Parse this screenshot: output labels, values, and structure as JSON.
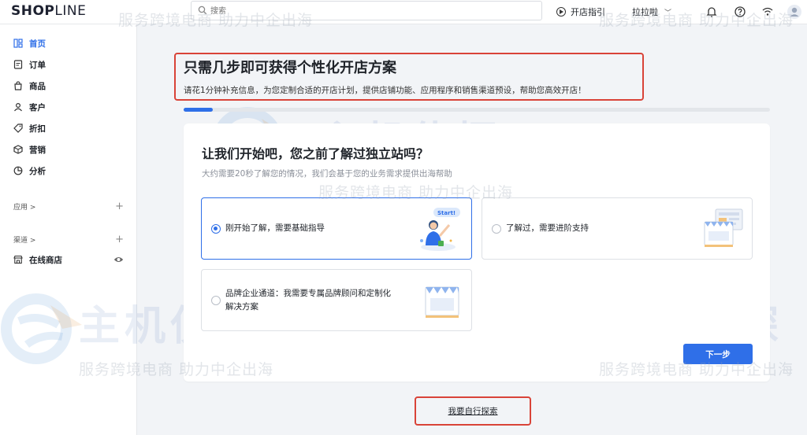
{
  "app": {
    "logo_main": "SHOP",
    "logo_rest": "LINE"
  },
  "topbar": {
    "search_placeholder": "搜索",
    "guide_label": "开店指引",
    "store_name": "拉拉啦",
    "icons": [
      "bell-icon",
      "help-icon",
      "wifi-icon",
      "avatar"
    ]
  },
  "sidebar": {
    "items": [
      {
        "label": "首页",
        "icon": "home-icon",
        "active": true
      },
      {
        "label": "订单",
        "icon": "order-icon"
      },
      {
        "label": "商品",
        "icon": "bag-icon"
      },
      {
        "label": "客户",
        "icon": "user-icon"
      },
      {
        "label": "折扣",
        "icon": "tag-icon"
      },
      {
        "label": "营销",
        "icon": "marketing-icon"
      },
      {
        "label": "分析",
        "icon": "chart-icon"
      }
    ],
    "apps_label": "应用 >",
    "channels_label": "渠道 >",
    "online_store_label": "在线商店"
  },
  "main": {
    "title": "只需几步即可获得个性化开店方案",
    "subtitle": "请花1分钟补充信息，为您定制合适的开店计划，提供店铺功能、应用程序和销售渠道预设，帮助您高效开店！",
    "progress": 0.05,
    "question_title": "让我们开始吧，您之前了解过独立站吗？",
    "question_sub": "大约需要20秒了解您的情况，我们会基于您的业务需求提供出海帮助",
    "options": [
      {
        "label": "刚开始了解，需要基础指导",
        "selected": true,
        "badge": "Start!"
      },
      {
        "label": "了解过，需要进阶支持",
        "selected": false
      },
      {
        "label_line1": "品牌企业通道：我需要专属品牌顾问和定制化",
        "label_line2": "解决方案",
        "selected": false
      }
    ],
    "next_button": "下一步",
    "explore_link": "我要自行探索"
  },
  "watermark": {
    "line": "服务跨境电商 助力中企出海",
    "big": "主机侦探"
  },
  "colors": {
    "accent": "#2f6fe8",
    "highlight_border": "#d94338"
  }
}
